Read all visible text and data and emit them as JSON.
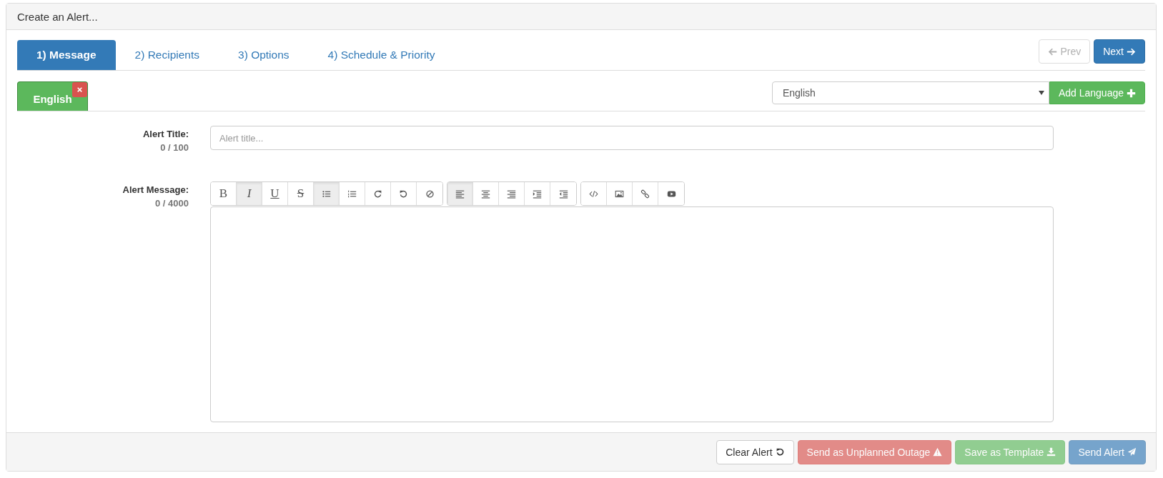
{
  "panel": {
    "title": "Create an Alert..."
  },
  "tabs": [
    {
      "label": "1) Message",
      "selected": true
    },
    {
      "label": "2) Recipients",
      "selected": false
    },
    {
      "label": "3) Options",
      "selected": false
    },
    {
      "label": "4) Schedule & Priority",
      "selected": false
    }
  ],
  "nav": {
    "prev": {
      "label": "Prev",
      "disabled": true
    },
    "next": {
      "label": "Next",
      "disabled": false
    }
  },
  "language_tabs": [
    {
      "label": "English",
      "selected": true
    }
  ],
  "language_select": {
    "value": "English"
  },
  "add_language": {
    "label": "Add Language"
  },
  "fields": [
    {
      "label": "Alert Title:",
      "counter": "0 / 100",
      "kind": "input",
      "placeholder": "Alert title..."
    },
    {
      "label": "Alert Message:",
      "counter": "0 / 4000",
      "kind": "editor"
    }
  ],
  "toolbar": [
    [
      {
        "kind": "bold",
        "label": "B",
        "active": false
      },
      {
        "kind": "italic",
        "label": "I",
        "active": true
      },
      {
        "kind": "underline",
        "label": "U",
        "active": false
      },
      {
        "kind": "strike",
        "label": "S",
        "active": false
      },
      {
        "kind": "bullets",
        "active": true
      },
      {
        "kind": "numbers",
        "active": false
      },
      {
        "kind": "redo",
        "active": false
      },
      {
        "kind": "undo",
        "active": false
      },
      {
        "kind": "clear",
        "active": false
      }
    ],
    [
      {
        "kind": "align-left",
        "active": true
      },
      {
        "kind": "align-center",
        "active": false
      },
      {
        "kind": "align-right",
        "active": false
      },
      {
        "kind": "indent",
        "active": false
      },
      {
        "kind": "outdent",
        "active": false
      }
    ],
    [
      {
        "kind": "code",
        "active": false
      },
      {
        "kind": "image",
        "active": false
      },
      {
        "kind": "link",
        "active": false
      },
      {
        "kind": "video",
        "active": false
      }
    ]
  ],
  "footer_buttons": [
    {
      "label": "Clear Alert",
      "kind": "default",
      "disabled": false
    },
    {
      "label": "Send as Unplanned Outage",
      "kind": "danger",
      "disabled": true
    },
    {
      "label": "Save as Template",
      "kind": "success",
      "disabled": true
    },
    {
      "label": "Send Alert",
      "kind": "primary",
      "disabled": true
    }
  ]
}
